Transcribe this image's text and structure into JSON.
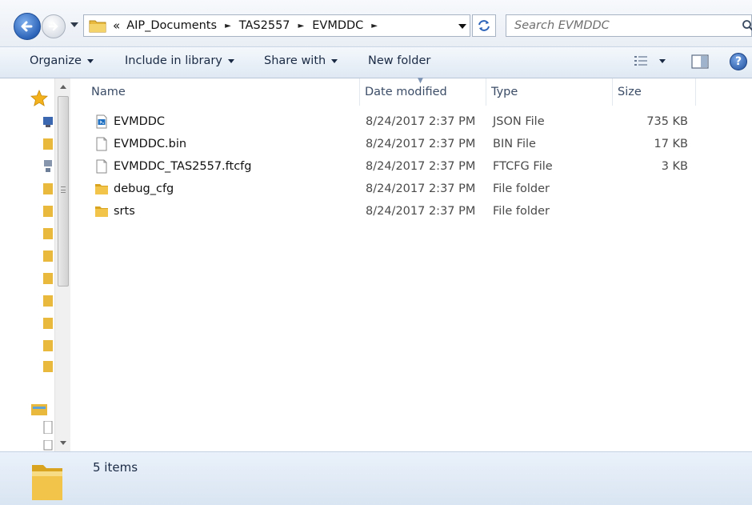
{
  "address": {
    "overflow_chevron": "«",
    "crumbs": [
      "AIP_Documents",
      "TAS2557",
      "EVMDDC"
    ],
    "separator": "►"
  },
  "search": {
    "placeholder": "Search EVMDDC"
  },
  "toolbar": {
    "organize_label": "Organize",
    "include_label": "Include in library",
    "share_label": "Share with",
    "newfolder_label": "New folder",
    "help_label": "?"
  },
  "columns": {
    "name": "Name",
    "date": "Date modified",
    "type": "Type",
    "size": "Size"
  },
  "files": [
    {
      "name": "EVMDDC",
      "date": "8/24/2017 2:37 PM",
      "type": "JSON File",
      "size": "735 KB",
      "icon": "json-file-icon"
    },
    {
      "name": "EVMDDC.bin",
      "date": "8/24/2017 2:37 PM",
      "type": "BIN File",
      "size": "17 KB",
      "icon": "generic-file-icon"
    },
    {
      "name": "EVMDDC_TAS2557.ftcfg",
      "date": "8/24/2017 2:37 PM",
      "type": "FTCFG File",
      "size": "3 KB",
      "icon": "generic-file-icon"
    },
    {
      "name": "debug_cfg",
      "date": "8/24/2017 2:37 PM",
      "type": "File folder",
      "size": "",
      "icon": "folder-icon"
    },
    {
      "name": "srts",
      "date": "8/24/2017 2:37 PM",
      "type": "File folder",
      "size": "",
      "icon": "folder-icon"
    }
  ],
  "status": {
    "count_text": "5 items"
  },
  "colors": {
    "folder": "#e8b93c",
    "accent": "#2d64b9",
    "toolbar_text": "#1a2a44"
  }
}
